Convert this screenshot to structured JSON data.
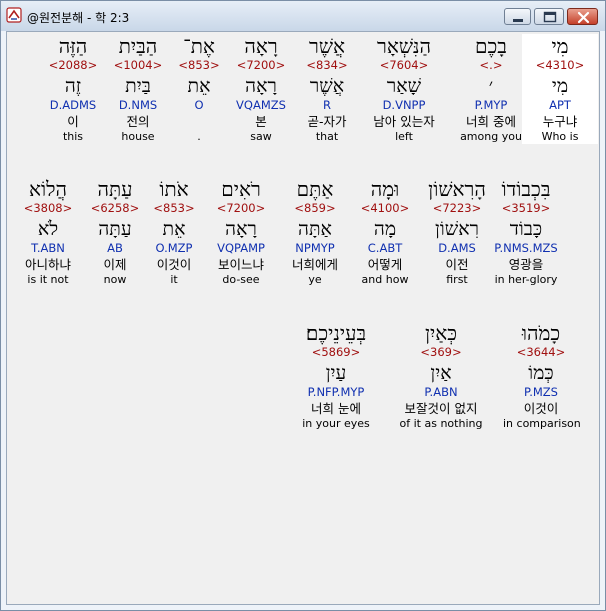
{
  "window": {
    "title": "@원전분해 - 학 2:3",
    "colors": {
      "strong": "#a01010",
      "morph": "#1030b0",
      "text": "#000000",
      "selected_bg": "#ffffff"
    }
  },
  "rows": [
    {
      "words": [
        {
          "hebrew": "מִי",
          "strong": "<4310>",
          "lemma": "מִי",
          "morph": "APT",
          "korean": "누구냐",
          "english": "Who is",
          "selected": true
        },
        {
          "hebrew": "בָכֶם",
          "strong": "<.>",
          "lemma": "׳",
          "morph": "P.MYP",
          "korean": "너희 중에",
          "english": "among you"
        },
        {
          "hebrew": "הַנִּשְׁאָר",
          "strong": "<7604>",
          "lemma": "שָׁאַר",
          "morph": "D.VNPP",
          "korean": "남아 있는자",
          "english": "left"
        },
        {
          "hebrew": "אֲשֶׁר",
          "strong": "<834>",
          "lemma": "אֲשֶׁר",
          "morph": "R",
          "korean": "곧-자가",
          "english": "that"
        },
        {
          "hebrew": "רָאָה",
          "strong": "<7200>",
          "lemma": "רָאָה",
          "morph": "VQAMZS",
          "korean": "본",
          "english": "saw"
        },
        {
          "hebrew": "אֶת־",
          "strong": "<853>",
          "lemma": "אֵת",
          "morph": "O",
          "korean": "",
          "english": "."
        },
        {
          "hebrew": "הַבַּיִת",
          "strong": "<1004>",
          "lemma": "בַּיִת",
          "morph": "D.NMS",
          "korean": "전의",
          "english": "house"
        },
        {
          "hebrew": "הַזֶּה",
          "strong": "<2088>",
          "lemma": "זֶה",
          "morph": "D.ADMS",
          "korean": "이",
          "english": "this"
        }
      ]
    },
    {
      "words": [
        {
          "hebrew": "בִּכְבוֹדוֹ",
          "strong": "<3519>",
          "lemma": "כָּבוֹד",
          "morph": "P.NMS.MZS",
          "korean": "영광을",
          "english": "in her-glory"
        },
        {
          "hebrew": "הָרִאשׁוֹן",
          "strong": "<7223>",
          "lemma": "רִאשׁוֹן",
          "morph": "D.AMS",
          "korean": "이전",
          "english": "first"
        },
        {
          "hebrew": "וּמָה",
          "strong": "<4100>",
          "lemma": "מָה",
          "morph": "C.ABT",
          "korean": "어떻게",
          "english": "and how"
        },
        {
          "hebrew": "אַתֶּם",
          "strong": "<859>",
          "lemma": "אַתָּה",
          "morph": "NPMYP",
          "korean": "너희에게",
          "english": "ye"
        },
        {
          "hebrew": "רֹאִים",
          "strong": "<7200>",
          "lemma": "רָאָה",
          "morph": "VQPAMP",
          "korean": "보이느냐",
          "english": "do-see"
        },
        {
          "hebrew": "אֹתוֹ",
          "strong": "<853>",
          "lemma": "אֵת",
          "morph": "O.MZP",
          "korean": "이것이",
          "english": "it"
        },
        {
          "hebrew": "עַתָּה",
          "strong": "<6258>",
          "lemma": "עַתָּה",
          "morph": "AB",
          "korean": "이제",
          "english": "now"
        },
        {
          "hebrew": "הֲלוֹא",
          "strong": "<3808>",
          "lemma": "לֹא",
          "morph": "T.ABN",
          "korean": "아니하냐",
          "english": "is it not"
        }
      ]
    },
    {
      "words": [
        {
          "hebrew": "כָמֹהוּ",
          "strong": "<3644>",
          "lemma": "כְּמוֹ",
          "morph": "P.MZS",
          "korean": "이것이",
          "english": "in comparison"
        },
        {
          "hebrew": "כְּאַיִן",
          "strong": "<369>",
          "lemma": "אַיִן",
          "morph": "P.ABN",
          "korean": "보잘것이 없지",
          "english": "of it as nothing"
        },
        {
          "hebrew": "בְּעֵינֵיכֶם׃",
          "strong": "<5869>",
          "lemma": "עַיִן",
          "morph": "P.NFP.MYP",
          "korean": "너희 눈에",
          "english": "in your eyes"
        }
      ]
    }
  ]
}
